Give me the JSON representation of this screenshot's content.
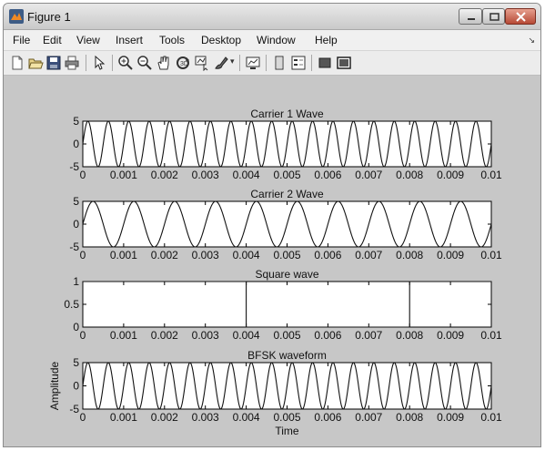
{
  "window": {
    "title": "Figure 1"
  },
  "menu": [
    "File",
    "Edit",
    "View",
    "Insert",
    "Tools",
    "Desktop",
    "Window",
    "Help"
  ],
  "toolbar": {
    "icons": [
      "new-figure-icon",
      "open-file-icon",
      "save-icon",
      "print-icon",
      "pointer-icon",
      "zoom-in-icon",
      "zoom-out-icon",
      "pan-hand-icon",
      "rotate-3d-icon",
      "data-cursor-icon",
      "brush-icon",
      "link-plot-icon",
      "colorbar-icon",
      "legend-icon",
      "hide-plot-tools-icon",
      "show-plot-tools-icon"
    ]
  },
  "chart_data": [
    {
      "type": "line",
      "title": "Carrier 1 Wave",
      "xlabel": "",
      "ylabel": "",
      "xlim": [
        0,
        0.01
      ],
      "ylim": [
        -5,
        5
      ],
      "x_ticks": [
        "0",
        "0.001",
        "0.002",
        "0.003",
        "0.004",
        "0.005",
        "0.006",
        "0.007",
        "0.008",
        "0.009",
        "0.01"
      ],
      "y_ticks": [
        "5",
        "0",
        "-5"
      ],
      "series": [
        {
          "function": "5*sin(2*pi*f*t)",
          "amplitude": 5,
          "frequency_hz": 2000
        }
      ]
    },
    {
      "type": "line",
      "title": "Carrier 2 Wave",
      "xlabel": "",
      "ylabel": "",
      "xlim": [
        0,
        0.01
      ],
      "ylim": [
        -5,
        5
      ],
      "x_ticks": [
        "0",
        "0.001",
        "0.002",
        "0.003",
        "0.004",
        "0.005",
        "0.006",
        "0.007",
        "0.008",
        "0.009",
        "0.01"
      ],
      "y_ticks": [
        "5",
        "0",
        "-5"
      ],
      "series": [
        {
          "function": "5*sin(2*pi*f*t)",
          "amplitude": 5,
          "frequency_hz": 1000
        }
      ]
    },
    {
      "type": "line",
      "title": "Square wave",
      "xlabel": "",
      "ylabel": "",
      "xlim": [
        0,
        0.01
      ],
      "ylim": [
        0,
        1
      ],
      "x_ticks": [
        "0",
        "0.001",
        "0.002",
        "0.003",
        "0.004",
        "0.005",
        "0.006",
        "0.007",
        "0.008",
        "0.009",
        "0.01"
      ],
      "y_ticks": [
        "1",
        "0.5",
        "0"
      ],
      "series": [
        {
          "x": [
            0,
            0.004,
            0.004,
            0.008,
            0.008,
            0.01
          ],
          "y": [
            1,
            1,
            0,
            0,
            1,
            1
          ]
        }
      ]
    },
    {
      "type": "line",
      "title": "BFSK waveform",
      "xlabel": "Time",
      "ylabel": "Amplitude",
      "xlim": [
        0,
        0.01
      ],
      "ylim": [
        -5,
        5
      ],
      "x_ticks": [
        "0",
        "0.001",
        "0.002",
        "0.003",
        "0.004",
        "0.005",
        "0.006",
        "0.007",
        "0.008",
        "0.009",
        "0.01"
      ],
      "y_ticks": [
        "5",
        "0",
        "-5"
      ],
      "series": [
        {
          "function": "5*sin(2*pi*f*t)",
          "amplitude": 5,
          "frequency_hz": 2000
        }
      ]
    }
  ]
}
